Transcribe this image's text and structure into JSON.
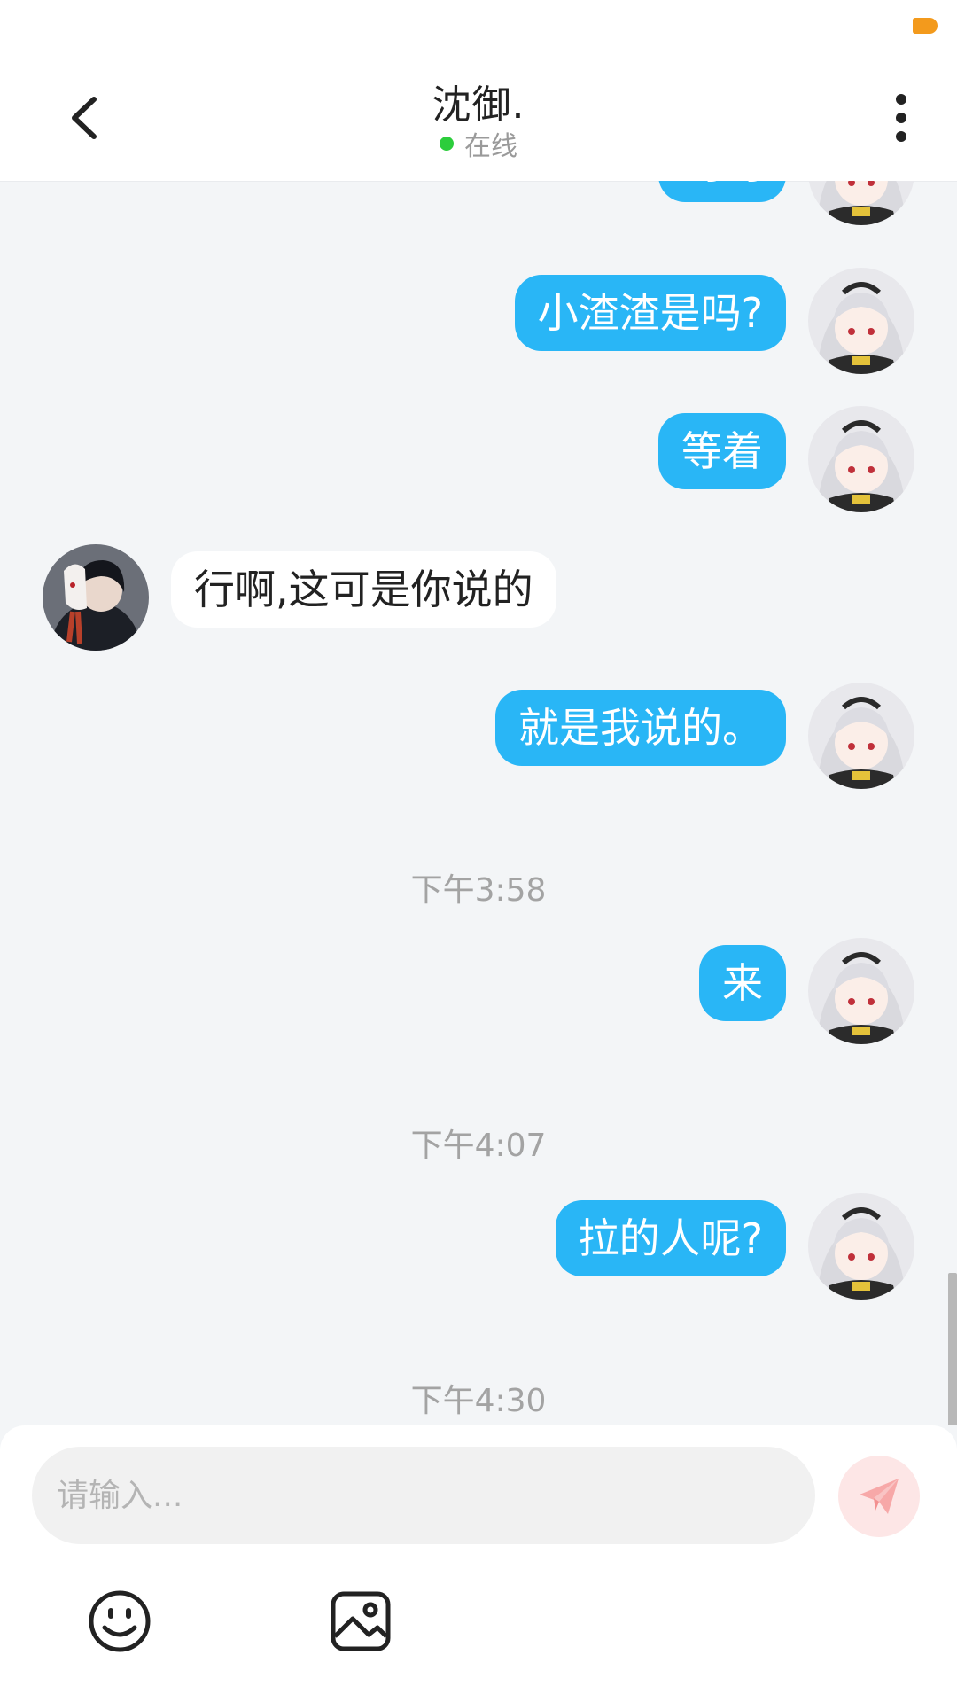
{
  "header": {
    "contact_name": "沈御.",
    "presence": "在线"
  },
  "messages": [
    {
      "from": "self",
      "text": "呵呵"
    },
    {
      "from": "self",
      "text": "小渣渣是吗?"
    },
    {
      "from": "self",
      "text": "等着"
    },
    {
      "from": "peer",
      "text": "行啊,这可是你说的"
    },
    {
      "from": "self",
      "text": "就是我说的。"
    },
    {
      "type": "time",
      "text": "下午3:58"
    },
    {
      "from": "self",
      "text": "来"
    },
    {
      "type": "time",
      "text": "下午4:07"
    },
    {
      "from": "self",
      "text": "拉的人呢?"
    },
    {
      "type": "time",
      "text": "下午4:30"
    }
  ],
  "composer": {
    "placeholder": "请输入...",
    "value": ""
  },
  "colors": {
    "self_bubble": "#29b6f6",
    "peer_bubble": "#ffffff",
    "online_dot": "#2ccd3c",
    "send_button_bg": "#fde6e6",
    "send_icon": "#f7a8a8",
    "battery": "#f39a1c"
  },
  "icons": {
    "back": "chevron-left-icon",
    "more": "more-vertical-icon",
    "send": "paper-plane-icon",
    "emoji": "smiley-icon",
    "image": "image-icon"
  }
}
